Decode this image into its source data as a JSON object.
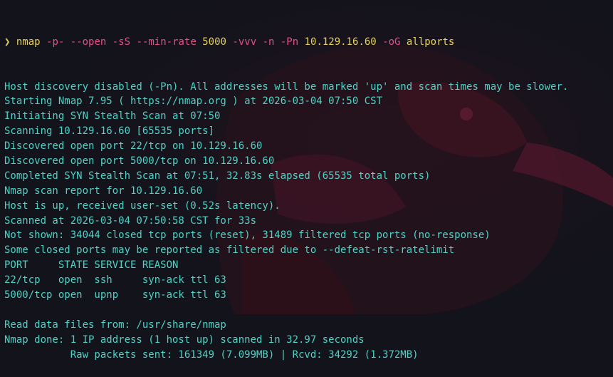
{
  "colors": {
    "background": "#13131b",
    "output_text": "#4fd1c5",
    "command_text": "#e6d05a",
    "flag_text": "#e24f86",
    "wallpaper_accent": "#3a1320"
  },
  "prompt": {
    "symbol": "❯",
    "command": "nmap",
    "tokens": [
      {
        "text": "-p-",
        "kind": "flag"
      },
      {
        "text": "--open",
        "kind": "flag"
      },
      {
        "text": "-sS",
        "kind": "flag"
      },
      {
        "text": "--min-rate",
        "kind": "flag"
      },
      {
        "text": "5000",
        "kind": "arg"
      },
      {
        "text": "-vvv",
        "kind": "flag"
      },
      {
        "text": "-n",
        "kind": "flag"
      },
      {
        "text": "-Pn",
        "kind": "flag"
      },
      {
        "text": "10.129.16.60",
        "kind": "arg"
      },
      {
        "text": "-oG",
        "kind": "flag"
      },
      {
        "text": "allports",
        "kind": "arg"
      }
    ]
  },
  "output_lines": [
    "Host discovery disabled (-Pn). All addresses will be marked 'up' and scan times may be slower.",
    "Starting Nmap 7.95 ( https://nmap.org ) at 2026-03-04 07:50 CST",
    "Initiating SYN Stealth Scan at 07:50",
    "Scanning 10.129.16.60 [65535 ports]",
    "Discovered open port 22/tcp on 10.129.16.60",
    "Discovered open port 5000/tcp on 10.129.16.60",
    "Completed SYN Stealth Scan at 07:51, 32.83s elapsed (65535 total ports)",
    "Nmap scan report for 10.129.16.60",
    "Host is up, received user-set (0.52s latency).",
    "Scanned at 2026-03-04 07:50:58 CST for 33s",
    "Not shown: 34044 closed tcp ports (reset), 31489 filtered tcp ports (no-response)",
    "Some closed ports may be reported as filtered due to --defeat-rst-ratelimit",
    "PORT     STATE SERVICE REASON",
    "22/tcp   open  ssh     syn-ack ttl 63",
    "5000/tcp open  upnp    syn-ack ttl 63",
    "",
    "Read data files from: /usr/share/nmap",
    "Nmap done: 1 IP address (1 host up) scanned in 32.97 seconds",
    "           Raw packets sent: 161349 (7.099MB) | Rcvd: 34292 (1.372MB)"
  ]
}
